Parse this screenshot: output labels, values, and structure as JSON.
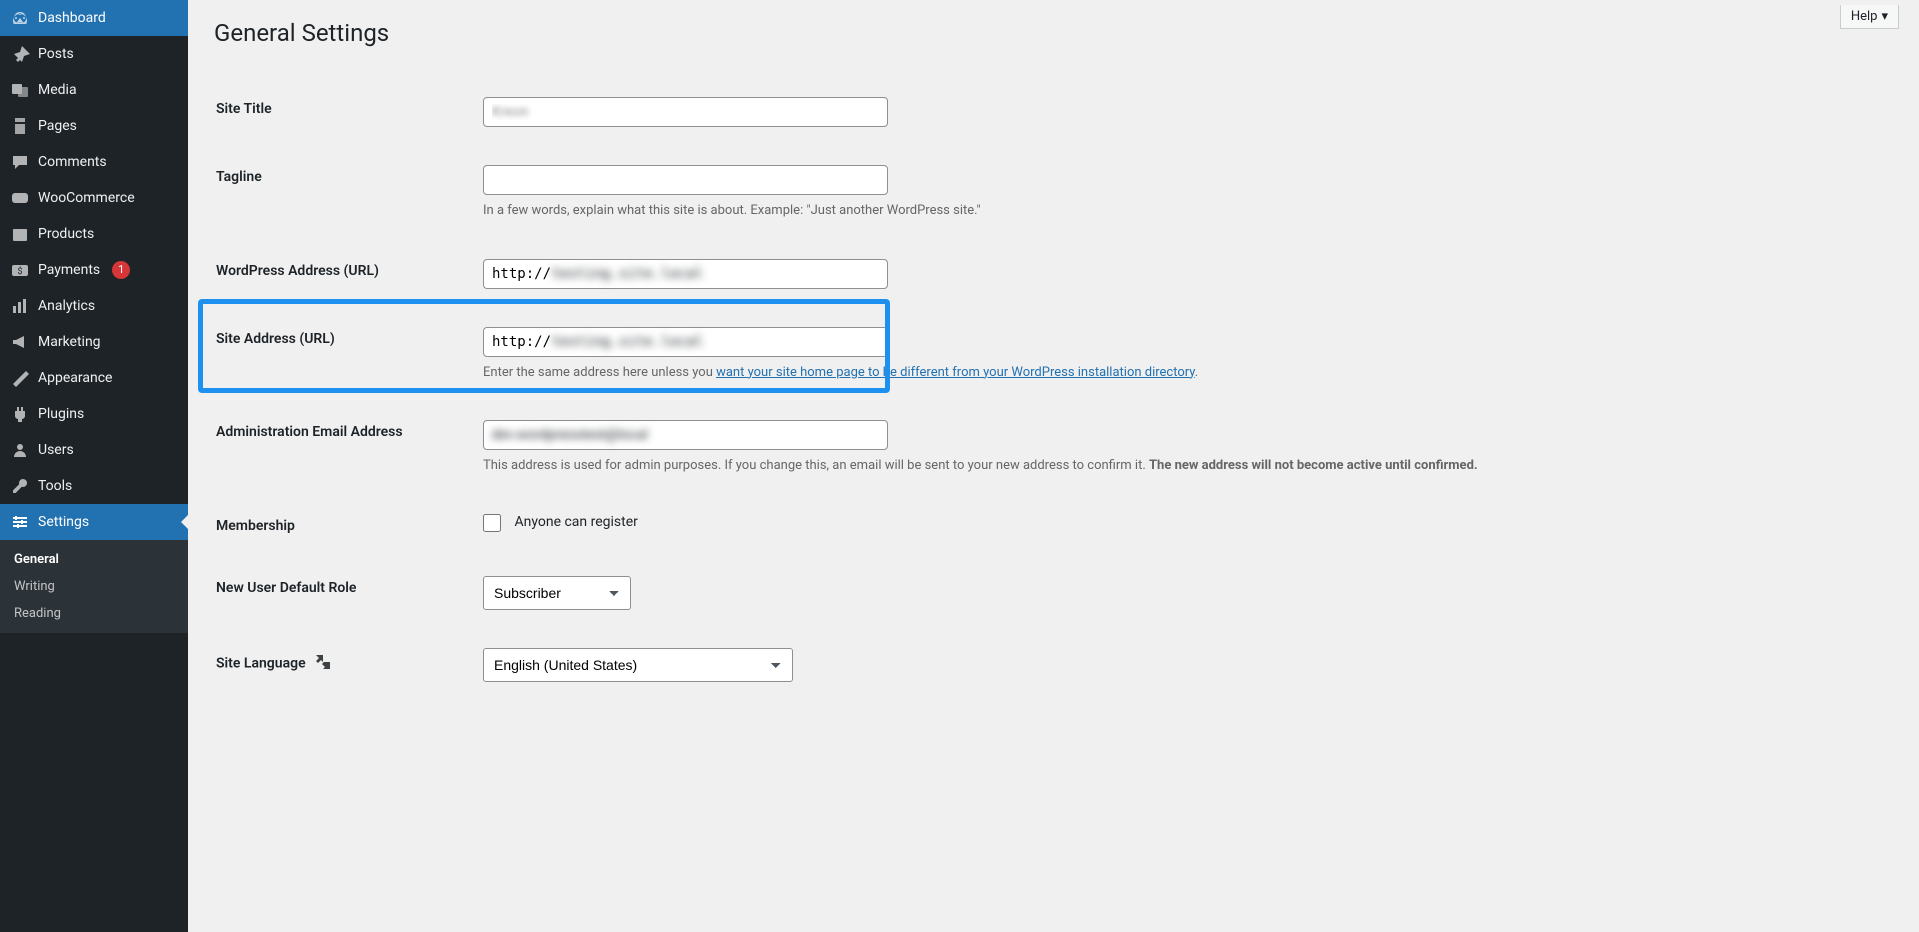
{
  "sidebar": {
    "items": [
      {
        "label": "Dashboard",
        "icon": "dashboard"
      },
      {
        "label": "Posts",
        "icon": "pin"
      },
      {
        "label": "Media",
        "icon": "media"
      },
      {
        "label": "Pages",
        "icon": "page"
      },
      {
        "label": "Comments",
        "icon": "comment"
      },
      {
        "label": "WooCommerce",
        "icon": "woo"
      },
      {
        "label": "Products",
        "icon": "products"
      },
      {
        "label": "Payments",
        "icon": "payments",
        "badge": "1"
      },
      {
        "label": "Analytics",
        "icon": "analytics"
      },
      {
        "label": "Marketing",
        "icon": "marketing"
      },
      {
        "label": "Appearance",
        "icon": "appearance"
      },
      {
        "label": "Plugins",
        "icon": "plugins"
      },
      {
        "label": "Users",
        "icon": "users"
      },
      {
        "label": "Tools",
        "icon": "tools"
      },
      {
        "label": "Settings",
        "icon": "settings"
      }
    ],
    "submenu": [
      "General",
      "Writing",
      "Reading"
    ]
  },
  "header": {
    "help": "Help"
  },
  "page": {
    "title": "General Settings"
  },
  "fields": {
    "site_title": {
      "label": "Site Title",
      "value": "Kreon"
    },
    "tagline": {
      "label": "Tagline",
      "value": "",
      "description": "In a few words, explain what this site is about. Example: \"Just another WordPress site.\""
    },
    "wp_address": {
      "label": "WordPress Address (URL)",
      "value": "http://testing.site.local"
    },
    "site_address": {
      "label": "Site Address (URL)",
      "value": "http://testing.site.local",
      "desc_before": "Enter the same address here unless you ",
      "desc_link": "want your site home page to be different from your WordPress installation directory",
      "desc_after": "."
    },
    "admin_email": {
      "label": "Administration Email Address",
      "value": "dev.wordpresstestlocal.com",
      "desc_plain": "This address is used for admin purposes. If you change this, an email will be sent to your new address to confirm it. ",
      "desc_bold": "The new address will not become active until confirmed."
    },
    "membership": {
      "label": "Membership",
      "checkbox_label": "Anyone can register"
    },
    "default_role": {
      "label": "New User Default Role",
      "selected": "Subscriber"
    },
    "site_language": {
      "label": "Site Language",
      "selected": "English (United States)"
    }
  }
}
